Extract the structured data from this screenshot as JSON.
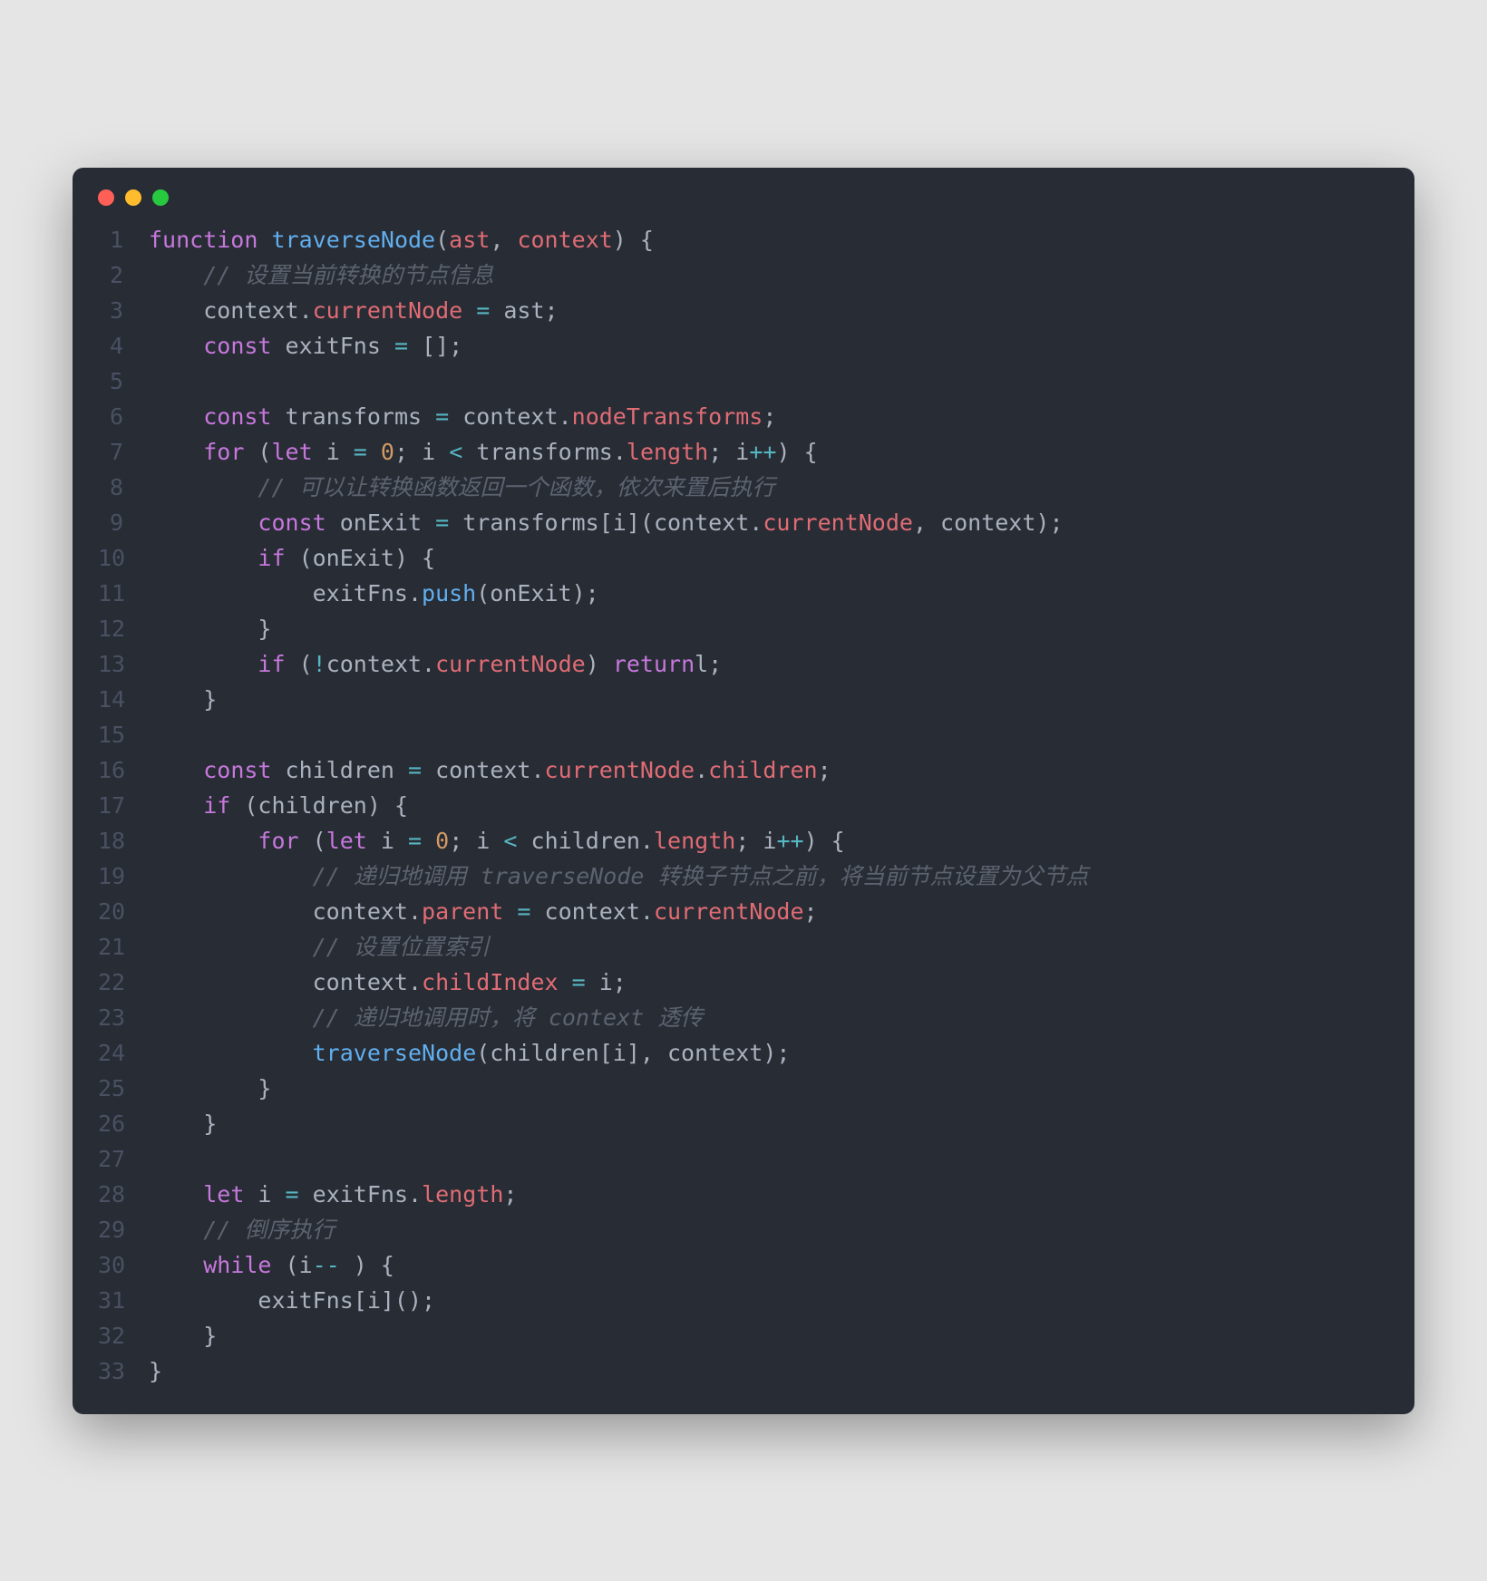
{
  "window": {
    "traffic": {
      "red": "#ff5f56",
      "yellow": "#ffbd2e",
      "green": "#27c93f"
    }
  },
  "theme": {
    "background": "#282c34",
    "text": "#abb2bf",
    "keyword": "#c678dd",
    "function": "#61afef",
    "property": "#e06c75",
    "number": "#d19a66",
    "comment": "#5c6370",
    "operator": "#56b6c2",
    "lineNumber": "#495162"
  },
  "code": {
    "lines": [
      {
        "n": 1,
        "tokens": [
          {
            "t": "function",
            "c": "kw"
          },
          {
            "t": " ",
            "c": "punc"
          },
          {
            "t": "traverseNode",
            "c": "fn"
          },
          {
            "t": "(",
            "c": "punc"
          },
          {
            "t": "ast",
            "c": "param"
          },
          {
            "t": ", ",
            "c": "punc"
          },
          {
            "t": "context",
            "c": "param"
          },
          {
            "t": ") {",
            "c": "punc"
          }
        ]
      },
      {
        "n": 2,
        "tokens": [
          {
            "t": "    ",
            "c": "punc"
          },
          {
            "t": "// 设置当前转换的节点信息",
            "c": "cmt"
          }
        ]
      },
      {
        "n": 3,
        "tokens": [
          {
            "t": "    context.",
            "c": "punc"
          },
          {
            "t": "currentNode",
            "c": "prop"
          },
          {
            "t": " ",
            "c": "punc"
          },
          {
            "t": "=",
            "c": "op"
          },
          {
            "t": " ast;",
            "c": "punc"
          }
        ]
      },
      {
        "n": 4,
        "tokens": [
          {
            "t": "    ",
            "c": "punc"
          },
          {
            "t": "const",
            "c": "kw"
          },
          {
            "t": " exitFns ",
            "c": "punc"
          },
          {
            "t": "=",
            "c": "op"
          },
          {
            "t": " [];",
            "c": "punc"
          }
        ]
      },
      {
        "n": 5,
        "tokens": [
          {
            "t": "",
            "c": "punc"
          }
        ]
      },
      {
        "n": 6,
        "tokens": [
          {
            "t": "    ",
            "c": "punc"
          },
          {
            "t": "const",
            "c": "kw"
          },
          {
            "t": " transforms ",
            "c": "punc"
          },
          {
            "t": "=",
            "c": "op"
          },
          {
            "t": " context.",
            "c": "punc"
          },
          {
            "t": "nodeTransforms",
            "c": "prop"
          },
          {
            "t": ";",
            "c": "punc"
          }
        ]
      },
      {
        "n": 7,
        "tokens": [
          {
            "t": "    ",
            "c": "punc"
          },
          {
            "t": "for",
            "c": "kw"
          },
          {
            "t": " (",
            "c": "punc"
          },
          {
            "t": "let",
            "c": "kw"
          },
          {
            "t": " i ",
            "c": "punc"
          },
          {
            "t": "=",
            "c": "op"
          },
          {
            "t": " ",
            "c": "punc"
          },
          {
            "t": "0",
            "c": "num"
          },
          {
            "t": "; i ",
            "c": "punc"
          },
          {
            "t": "<",
            "c": "op"
          },
          {
            "t": " transforms.",
            "c": "punc"
          },
          {
            "t": "length",
            "c": "prop"
          },
          {
            "t": "; i",
            "c": "punc"
          },
          {
            "t": "++",
            "c": "op"
          },
          {
            "t": ") {",
            "c": "punc"
          }
        ]
      },
      {
        "n": 8,
        "tokens": [
          {
            "t": "        ",
            "c": "punc"
          },
          {
            "t": "// 可以让转换函数返回一个函数，依次来置后执行",
            "c": "cmt"
          }
        ]
      },
      {
        "n": 9,
        "tokens": [
          {
            "t": "        ",
            "c": "punc"
          },
          {
            "t": "const",
            "c": "kw"
          },
          {
            "t": " onExit ",
            "c": "punc"
          },
          {
            "t": "=",
            "c": "op"
          },
          {
            "t": " transforms[i](context.",
            "c": "punc"
          },
          {
            "t": "currentNode",
            "c": "prop"
          },
          {
            "t": ", context);",
            "c": "punc"
          }
        ]
      },
      {
        "n": 10,
        "tokens": [
          {
            "t": "        ",
            "c": "punc"
          },
          {
            "t": "if",
            "c": "kw"
          },
          {
            "t": " (onExit) {",
            "c": "punc"
          }
        ]
      },
      {
        "n": 11,
        "tokens": [
          {
            "t": "            exitFns.",
            "c": "punc"
          },
          {
            "t": "push",
            "c": "fn"
          },
          {
            "t": "(onExit);",
            "c": "punc"
          }
        ]
      },
      {
        "n": 12,
        "tokens": [
          {
            "t": "        }",
            "c": "punc"
          }
        ]
      },
      {
        "n": 13,
        "tokens": [
          {
            "t": "        ",
            "c": "punc"
          },
          {
            "t": "if",
            "c": "kw"
          },
          {
            "t": " (",
            "c": "punc"
          },
          {
            "t": "!",
            "c": "op"
          },
          {
            "t": "context.",
            "c": "punc"
          },
          {
            "t": "currentNode",
            "c": "prop"
          },
          {
            "t": ") ",
            "c": "punc"
          },
          {
            "t": "return",
            "c": "kw"
          },
          {
            "t": "l;",
            "c": "punc"
          }
        ]
      },
      {
        "n": 14,
        "tokens": [
          {
            "t": "    }",
            "c": "punc"
          }
        ]
      },
      {
        "n": 15,
        "tokens": [
          {
            "t": "",
            "c": "punc"
          }
        ]
      },
      {
        "n": 16,
        "tokens": [
          {
            "t": "    ",
            "c": "punc"
          },
          {
            "t": "const",
            "c": "kw"
          },
          {
            "t": " children ",
            "c": "punc"
          },
          {
            "t": "=",
            "c": "op"
          },
          {
            "t": " context.",
            "c": "punc"
          },
          {
            "t": "currentNode",
            "c": "prop"
          },
          {
            "t": ".",
            "c": "punc"
          },
          {
            "t": "children",
            "c": "prop"
          },
          {
            "t": ";",
            "c": "punc"
          }
        ]
      },
      {
        "n": 17,
        "tokens": [
          {
            "t": "    ",
            "c": "punc"
          },
          {
            "t": "if",
            "c": "kw"
          },
          {
            "t": " (children) {",
            "c": "punc"
          }
        ]
      },
      {
        "n": 18,
        "tokens": [
          {
            "t": "        ",
            "c": "punc"
          },
          {
            "t": "for",
            "c": "kw"
          },
          {
            "t": " (",
            "c": "punc"
          },
          {
            "t": "let",
            "c": "kw"
          },
          {
            "t": " i ",
            "c": "punc"
          },
          {
            "t": "=",
            "c": "op"
          },
          {
            "t": " ",
            "c": "punc"
          },
          {
            "t": "0",
            "c": "num"
          },
          {
            "t": "; i ",
            "c": "punc"
          },
          {
            "t": "<",
            "c": "op"
          },
          {
            "t": " children.",
            "c": "punc"
          },
          {
            "t": "length",
            "c": "prop"
          },
          {
            "t": "; i",
            "c": "punc"
          },
          {
            "t": "++",
            "c": "op"
          },
          {
            "t": ") {",
            "c": "punc"
          }
        ]
      },
      {
        "n": 19,
        "tokens": [
          {
            "t": "            ",
            "c": "punc"
          },
          {
            "t": "// 递归地调用 traverseNode 转换子节点之前，将当前节点设置为父节点",
            "c": "cmt"
          }
        ]
      },
      {
        "n": 20,
        "tokens": [
          {
            "t": "            context.",
            "c": "punc"
          },
          {
            "t": "parent",
            "c": "prop"
          },
          {
            "t": " ",
            "c": "punc"
          },
          {
            "t": "=",
            "c": "op"
          },
          {
            "t": " context.",
            "c": "punc"
          },
          {
            "t": "currentNode",
            "c": "prop"
          },
          {
            "t": ";",
            "c": "punc"
          }
        ]
      },
      {
        "n": 21,
        "tokens": [
          {
            "t": "            ",
            "c": "punc"
          },
          {
            "t": "// 设置位置索引",
            "c": "cmt"
          }
        ]
      },
      {
        "n": 22,
        "tokens": [
          {
            "t": "            context.",
            "c": "punc"
          },
          {
            "t": "childIndex",
            "c": "prop"
          },
          {
            "t": " ",
            "c": "punc"
          },
          {
            "t": "=",
            "c": "op"
          },
          {
            "t": " i;",
            "c": "punc"
          }
        ]
      },
      {
        "n": 23,
        "tokens": [
          {
            "t": "            ",
            "c": "punc"
          },
          {
            "t": "// 递归地调用时，将 context 透传",
            "c": "cmt"
          }
        ]
      },
      {
        "n": 24,
        "tokens": [
          {
            "t": "            ",
            "c": "punc"
          },
          {
            "t": "traverseNode",
            "c": "fn"
          },
          {
            "t": "(children[i], context);",
            "c": "punc"
          }
        ]
      },
      {
        "n": 25,
        "tokens": [
          {
            "t": "        }",
            "c": "punc"
          }
        ]
      },
      {
        "n": 26,
        "tokens": [
          {
            "t": "    }",
            "c": "punc"
          }
        ]
      },
      {
        "n": 27,
        "tokens": [
          {
            "t": "",
            "c": "punc"
          }
        ]
      },
      {
        "n": 28,
        "tokens": [
          {
            "t": "    ",
            "c": "punc"
          },
          {
            "t": "let",
            "c": "kw"
          },
          {
            "t": " i ",
            "c": "punc"
          },
          {
            "t": "=",
            "c": "op"
          },
          {
            "t": " exitFns.",
            "c": "punc"
          },
          {
            "t": "length",
            "c": "prop"
          },
          {
            "t": ";",
            "c": "punc"
          }
        ]
      },
      {
        "n": 29,
        "tokens": [
          {
            "t": "    ",
            "c": "punc"
          },
          {
            "t": "// 倒序执行",
            "c": "cmt"
          }
        ]
      },
      {
        "n": 30,
        "tokens": [
          {
            "t": "    ",
            "c": "punc"
          },
          {
            "t": "while",
            "c": "kw"
          },
          {
            "t": " (i",
            "c": "punc"
          },
          {
            "t": "--",
            "c": "op"
          },
          {
            "t": " ) {",
            "c": "punc"
          }
        ]
      },
      {
        "n": 31,
        "tokens": [
          {
            "t": "        exitFns[i]();",
            "c": "punc"
          }
        ]
      },
      {
        "n": 32,
        "tokens": [
          {
            "t": "    }",
            "c": "punc"
          }
        ]
      },
      {
        "n": 33,
        "tokens": [
          {
            "t": "}",
            "c": "punc"
          }
        ]
      }
    ]
  }
}
